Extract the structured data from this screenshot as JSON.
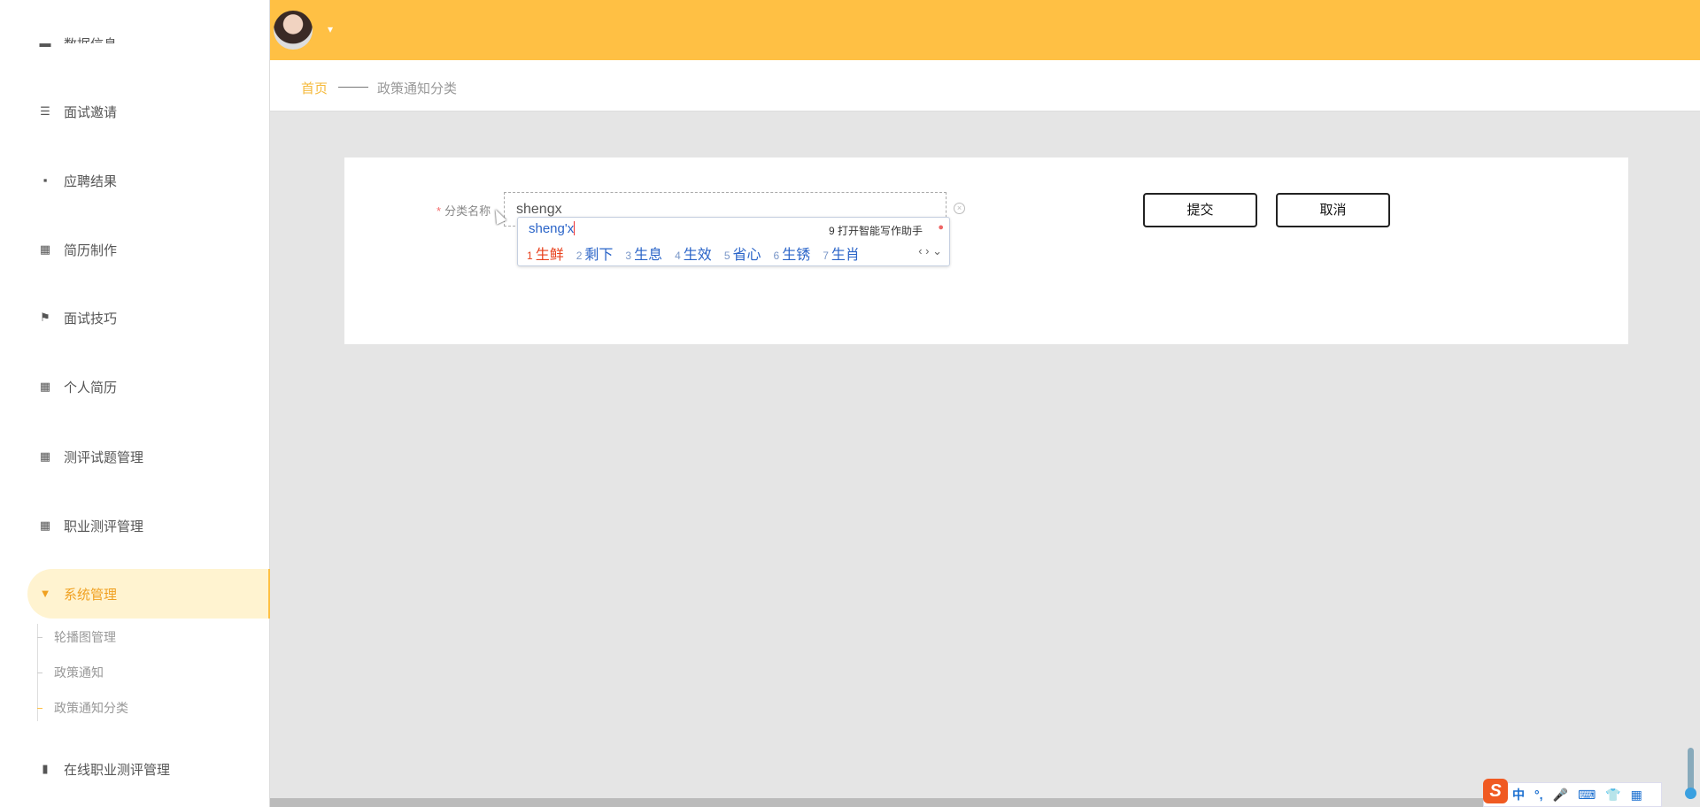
{
  "sidebar": {
    "items": [
      {
        "label": "数据信息",
        "icon": "list-icon"
      },
      {
        "label": "面试邀请",
        "icon": "sliders-icon"
      },
      {
        "label": "应聘结果",
        "icon": "chat-icon"
      },
      {
        "label": "简历制作",
        "icon": "grid-icon"
      },
      {
        "label": "面试技巧",
        "icon": "flag-icon"
      },
      {
        "label": "个人简历",
        "icon": "grid-icon"
      },
      {
        "label": "测评试题管理",
        "icon": "grid-icon"
      },
      {
        "label": "职业测评管理",
        "icon": "grid-icon"
      },
      {
        "label": "系统管理",
        "icon": "system-icon"
      },
      {
        "label": "在线职业测评管理",
        "icon": "bar-chart-icon"
      }
    ],
    "submenu": [
      "轮播图管理",
      "政策通知",
      "政策通知分类"
    ]
  },
  "header": {
    "caret": "▾"
  },
  "breadcrumb": {
    "home": "首页",
    "current": "政策通知分类"
  },
  "form": {
    "required_mark": "*",
    "label": "分类名称",
    "value": "shengx",
    "clear": "×",
    "submit": "提交",
    "cancel": "取消"
  },
  "ime": {
    "composition": "sheng'x",
    "assist": "9 打开智能写作助手",
    "candidates": [
      {
        "n": "1",
        "t": "生鲜"
      },
      {
        "n": "2",
        "t": "剩下"
      },
      {
        "n": "3",
        "t": "生息"
      },
      {
        "n": "4",
        "t": "生效"
      },
      {
        "n": "5",
        "t": "省心"
      },
      {
        "n": "6",
        "t": "生锈"
      },
      {
        "n": "7",
        "t": "生肖"
      }
    ],
    "nav": "‹ › ⌄",
    "toolbar": {
      "logo": "S",
      "mode": "中",
      "punct": "°,",
      "mic": "🎤",
      "keyboard": "⌨",
      "skin": "👕",
      "apps": "▦"
    }
  },
  "colors": {
    "accent": "#ffc044",
    "active_bg": "#fff3d0"
  }
}
